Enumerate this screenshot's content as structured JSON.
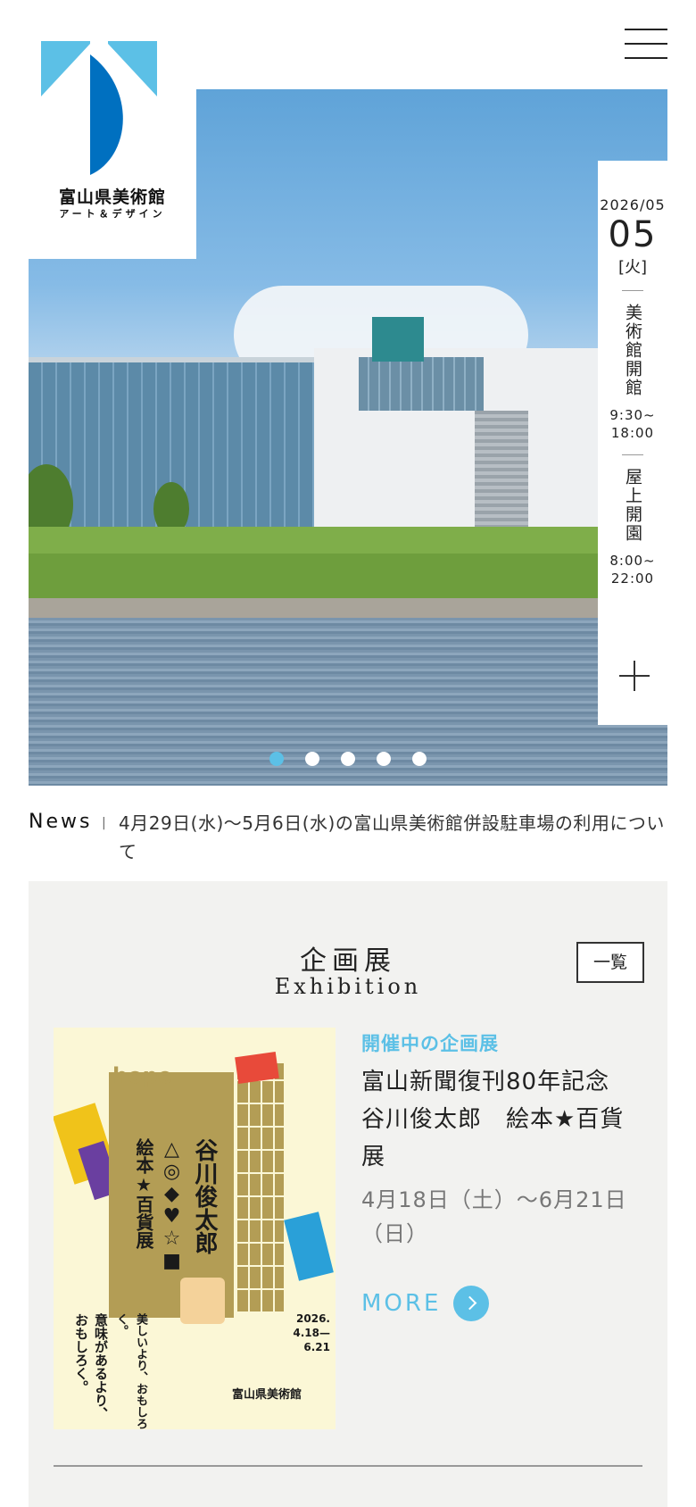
{
  "logo": {
    "name": "富山県美術館",
    "sub": "アート＆デザイン"
  },
  "menu": {
    "icon": "hamburger-icon"
  },
  "date_panel": {
    "year_month": "2026/05",
    "day": "05",
    "weekday": "[火]",
    "museum_label": "美術館開館",
    "museum_hours": "9:30~\n18:00",
    "rooftop_label": "屋上開園",
    "rooftop_hours": "8:00~\n22:00",
    "expand_icon": "plus-icon"
  },
  "slider": {
    "count": 5,
    "active": 0
  },
  "news": {
    "label": "News",
    "separator": "|",
    "text": "4月29日(水)～5月6日(水)の富山県美術館併設駐車場の利用について"
  },
  "exhibition": {
    "title_ja": "企画展",
    "title_en": "Exhibition",
    "list_button": "一覧",
    "status": "開催中の企画展",
    "name": "富山新聞復刊80年記念\n谷川俊太郎　絵本★百貨展",
    "dates": "4月18日（土）～6月21日（日）",
    "more": "MORE",
    "poster": {
      "hope": "hope",
      "vt1": "谷川俊太郎",
      "vt2": "△◎◆♥☆■",
      "vt3": "絵本★百貨展",
      "lyric1": "意味があるより、おもしろく。",
      "lyric2": "美しいより、おもしろく。",
      "dates": "2026.\n4.18—6.21",
      "logo": "富山県美術館"
    }
  },
  "colors": {
    "accent": "#5cc0e6",
    "section_bg": "#f2f2f0",
    "logo_dark": "#0070c0",
    "logo_light": "#5cc0e6"
  }
}
